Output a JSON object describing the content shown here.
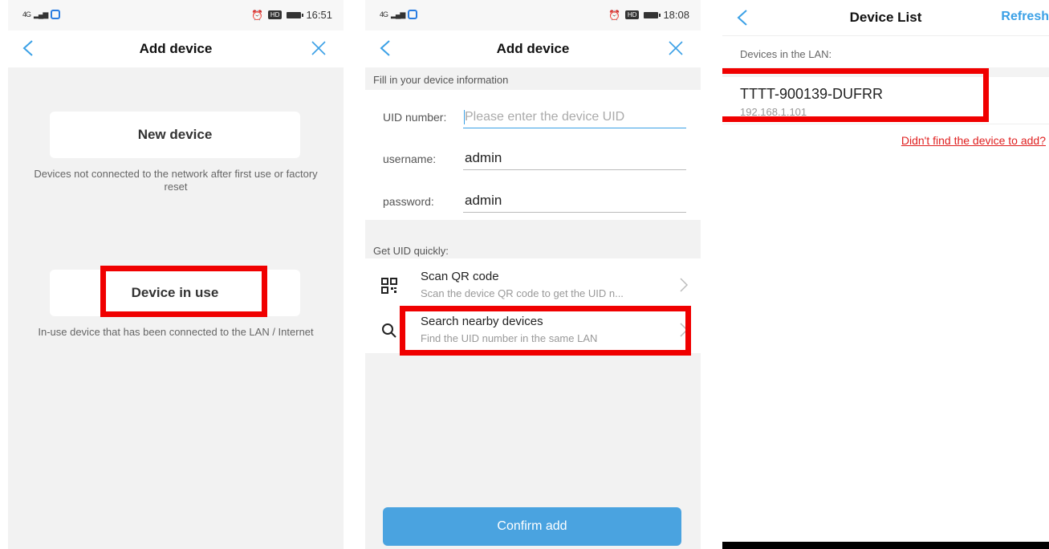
{
  "panel1": {
    "status": {
      "signal": "4G",
      "time": "16:51",
      "hd": "HD"
    },
    "nav": {
      "title": "Add device"
    },
    "new_device": {
      "label": "New device",
      "desc": "Devices not connected to the network after first use or factory reset"
    },
    "device_in_use": {
      "label": "Device in use",
      "desc": "In-use device that has been connected to the LAN / Internet"
    }
  },
  "panel2": {
    "status": {
      "signal": "4G",
      "time": "18:08",
      "hd": "HD"
    },
    "nav": {
      "title": "Add device"
    },
    "section_info": "Fill in your device information",
    "uid": {
      "label": "UID number:",
      "value": "",
      "placeholder": "Please enter the device UID"
    },
    "username": {
      "label": "username:",
      "value": "admin"
    },
    "password": {
      "label": "password:",
      "value": "admin"
    },
    "section_quick": "Get UID quickly:",
    "scan": {
      "title": "Scan QR code",
      "subtitle": "Scan the device QR code to get the UID n..."
    },
    "search": {
      "title": "Search nearby devices",
      "subtitle": "Find the UID number in the same LAN"
    },
    "confirm_label": "Confirm add"
  },
  "panel3": {
    "nav": {
      "title": "Device List",
      "refresh": "Refresh"
    },
    "lan_label": "Devices in the LAN:",
    "devices": [
      {
        "name": "TTTT-900139-DUFRR",
        "ip": "192.168.1.101"
      }
    ],
    "not_found_link": "Didn't find the device to add?"
  },
  "colors": {
    "accent": "#3aa0e6",
    "highlight": "#f00000",
    "link_red": "#e02020",
    "button_blue": "#4aa3e0"
  },
  "icons": [
    "back-chevron-icon",
    "close-x-icon",
    "qr-code-icon",
    "search-icon",
    "chevron-right-icon",
    "alarm-icon",
    "battery-icon",
    "signal-icon"
  ]
}
